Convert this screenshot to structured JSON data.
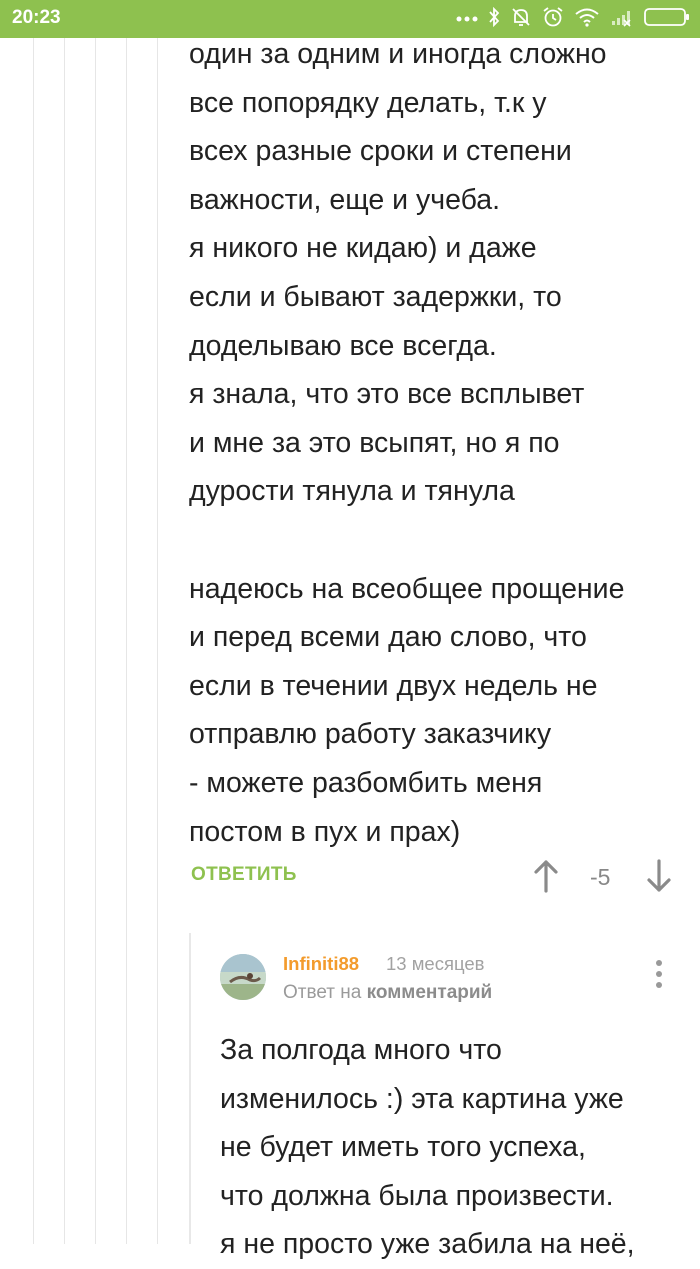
{
  "status_bar": {
    "time": "20:23"
  },
  "comment": {
    "lines": [
      "один за одним и иногда сложно",
      "все попорядку делать, т.к у",
      "всех разные сроки и степени",
      "важности, еще и учеба.",
      "я никого не кидаю) и даже",
      "если и бывают задержки, то",
      "доделываю все всегда.",
      "я знала, что это все всплывет",
      "и мне за это всыпят, но я по",
      "дурости тянула и тянула",
      "",
      "надеюсь на всеобщее прощение",
      "и перед всеми даю слово, что",
      "если в течении двух недель не",
      "отправлю работу заказчику",
      "- можете разбомбить меня",
      "постом в пух и прах)"
    ],
    "reply_label": "ОТВЕТИТЬ",
    "score": "-5"
  },
  "reply": {
    "author": "Infiniti88",
    "time_ago": "13 месяцев",
    "reply_to_prefix": "Ответ на",
    "reply_to_link": "комментарий",
    "lines": [
      "За полгода много что",
      "изменилось :) эта картина уже",
      "не будет иметь того успеха,",
      "что должна была произвести.",
      "я не просто уже забила на неё,"
    ]
  },
  "colors": {
    "accent_green": "#8ec14f",
    "author_orange": "#f39b2c"
  }
}
